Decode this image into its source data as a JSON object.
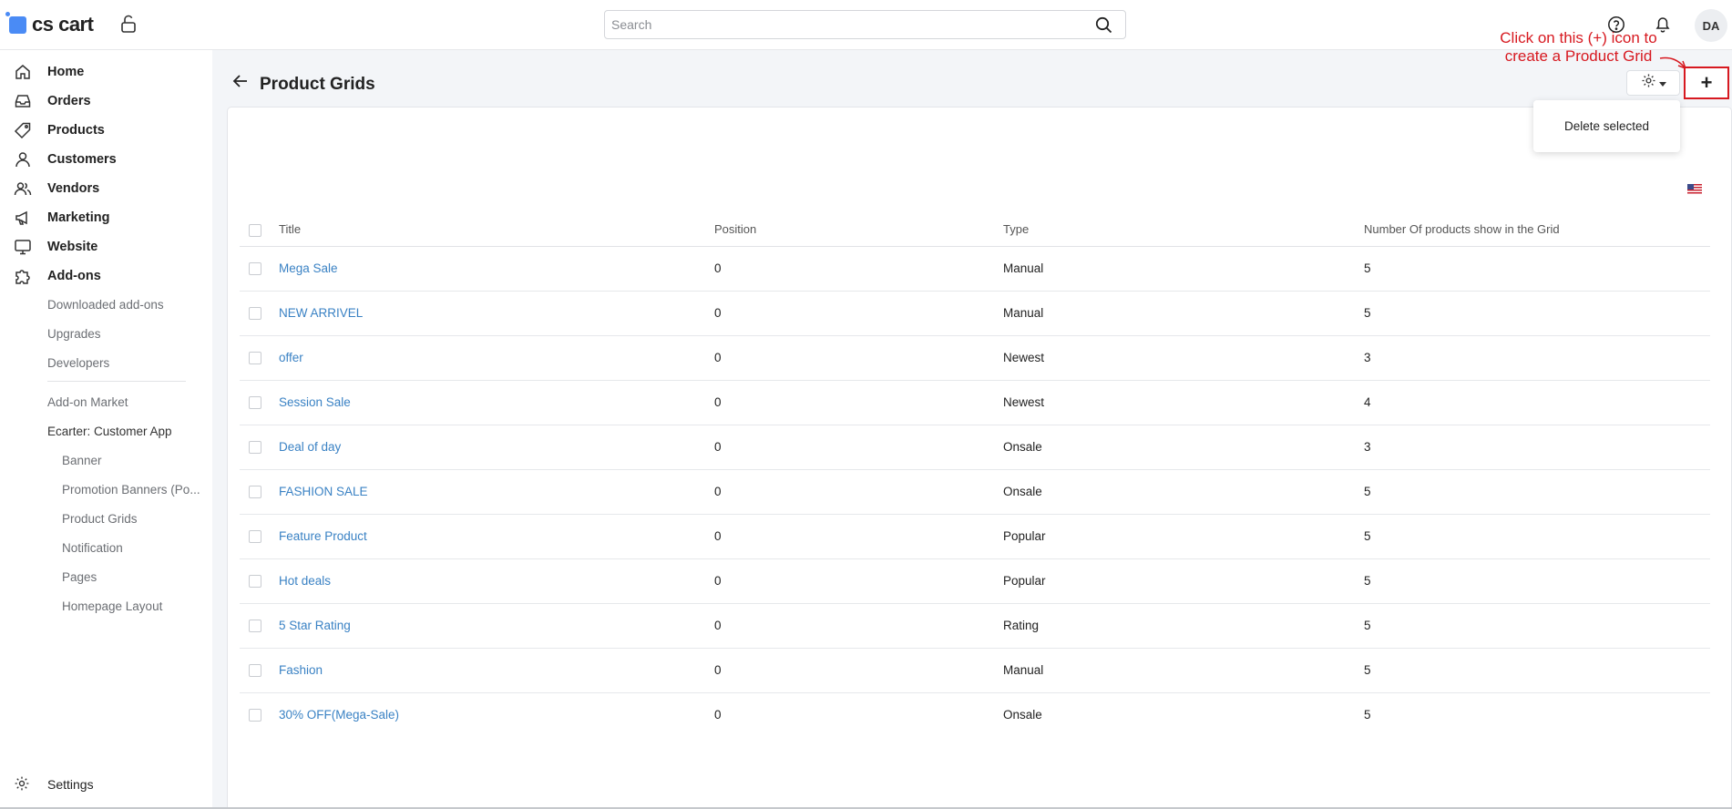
{
  "header": {
    "logo_text": "cs cart",
    "search_placeholder": "Search",
    "avatar_initials": "DA"
  },
  "sidebar": {
    "items": [
      {
        "label": "Home",
        "icon": "home-icon"
      },
      {
        "label": "Orders",
        "icon": "inbox-icon"
      },
      {
        "label": "Products",
        "icon": "tag-icon"
      },
      {
        "label": "Customers",
        "icon": "user-icon"
      },
      {
        "label": "Vendors",
        "icon": "users-icon"
      },
      {
        "label": "Marketing",
        "icon": "megaphone-icon"
      },
      {
        "label": "Website",
        "icon": "monitor-icon"
      },
      {
        "label": "Add-ons",
        "icon": "puzzle-icon"
      }
    ],
    "addons_sub": [
      "Downloaded add-ons",
      "Upgrades",
      "Developers"
    ],
    "addon_market": "Add-on Market",
    "ecarter": "Ecarter: Customer App",
    "ecarter_sub": [
      "Banner",
      "Promotion Banners (Po...",
      "Product Grids",
      "Notification",
      "Pages",
      "Homepage Layout"
    ],
    "settings": "Settings"
  },
  "main": {
    "title": "Product Grids",
    "dropdown_item": "Delete selected",
    "annotation": "Click on this (+) icon to create a Product Grid",
    "table": {
      "headers": [
        "Title",
        "Position",
        "Type",
        "Number Of products show in the Grid"
      ],
      "rows": [
        {
          "title": "Mega Sale",
          "position": "0",
          "type": "Manual",
          "count": "5"
        },
        {
          "title": "NEW ARRIVEL",
          "position": "0",
          "type": "Manual",
          "count": "5"
        },
        {
          "title": "offer",
          "position": "0",
          "type": "Newest",
          "count": "3"
        },
        {
          "title": "Session Sale",
          "position": "0",
          "type": "Newest",
          "count": "4"
        },
        {
          "title": "Deal of day",
          "position": "0",
          "type": "Onsale",
          "count": "3"
        },
        {
          "title": "FASHION SALE",
          "position": "0",
          "type": "Onsale",
          "count": "5"
        },
        {
          "title": "Feature Product",
          "position": "0",
          "type": "Popular",
          "count": "5"
        },
        {
          "title": "Hot deals",
          "position": "0",
          "type": "Popular",
          "count": "5"
        },
        {
          "title": "5 Star Rating",
          "position": "0",
          "type": "Rating",
          "count": "5"
        },
        {
          "title": "Fashion",
          "position": "0",
          "type": "Manual",
          "count": "5"
        },
        {
          "title": "30% OFF(Mega-Sale)",
          "position": "0",
          "type": "Onsale",
          "count": "5"
        }
      ]
    }
  },
  "colors": {
    "accent": "#4a8bf5",
    "link": "#3a82c4",
    "annotation": "#d71920",
    "main_bg": "#f3f5f8"
  }
}
